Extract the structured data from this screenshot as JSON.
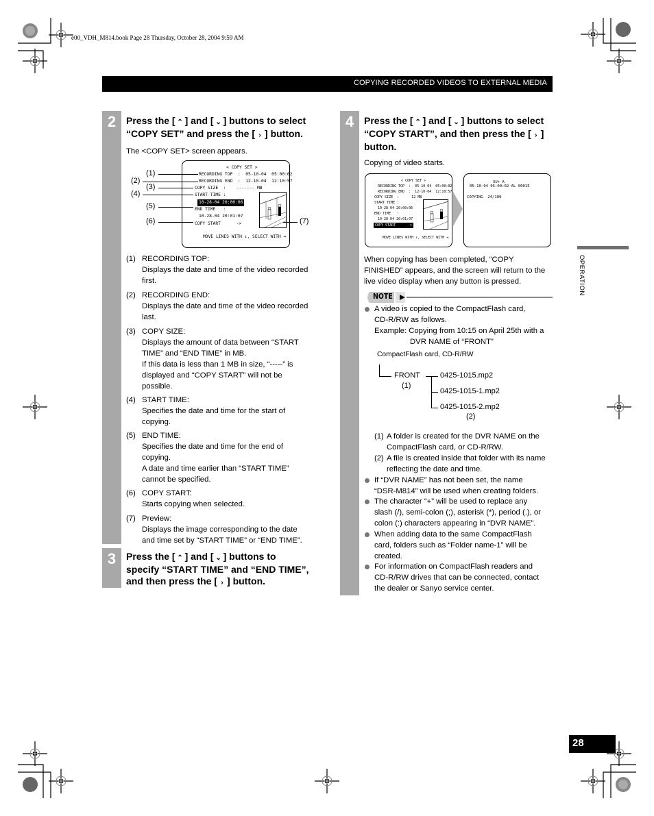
{
  "file_info": "e00_VDH_M814.book  Page 28  Thursday, October 28, 2004  9:59 AM",
  "header": {
    "title": "COPYING RECORDED VIDEOS TO EXTERNAL MEDIA"
  },
  "side_tab": {
    "label": "OPERATION"
  },
  "page_number": "28",
  "step2": {
    "number": "2",
    "title_line1": "Press the [",
    "title_line1_b": "] and [",
    "title_line1_c": "] buttons to select",
    "title_line2": "“COPY SET” and press the [",
    "title_line2_b": "] button.",
    "intro": "The <COPY SET> screen appears.",
    "screen": {
      "title": "< COPY SET >",
      "rows": [
        "RECORDING TOP  :  05-10-04  05:00:02",
        "RECORDING END  :  12-10-04  12:10:57",
        "COPY SIZE  :    ------- MB",
        "START TIME :",
        "10-28-04 20:00:06",
        "END TIME   :",
        "10-28-04 20:01:07",
        "COPY START      ->"
      ],
      "footer": "MOVE LINES WITH ↕, SELECT WITH ↔"
    },
    "callouts": [
      "(1)",
      "(2)",
      "(3)",
      "(4)",
      "(5)",
      "(6)",
      "(7)"
    ],
    "items": [
      {
        "num": "(1)",
        "lines": [
          "RECORDING TOP:",
          "Displays the date and time of the video recorded",
          "first."
        ]
      },
      {
        "num": "(2)",
        "lines": [
          "RECORDING END:",
          "Displays the date and time of the video recorded",
          "last."
        ]
      },
      {
        "num": "(3)",
        "lines": [
          "COPY SIZE:",
          "Displays the amount of data between “START",
          "TIME” and “END TIME” in MB.",
          "If this data is less than 1 MB in size, “-----” is",
          "displayed and “COPY START” will not be",
          "possible."
        ]
      },
      {
        "num": "(4)",
        "lines": [
          "START TIME:",
          "Specifies the date and time for the start of",
          "copying."
        ]
      },
      {
        "num": "(5)",
        "lines": [
          "END TIME:",
          "Specifies the date and time for the end of",
          "copying.",
          "A date and time earlier than “START TIME”",
          "cannot be specified."
        ]
      },
      {
        "num": "(6)",
        "lines": [
          "COPY START:",
          "Starts copying when selected."
        ]
      },
      {
        "num": "(7)",
        "lines": [
          "Preview:",
          "Displays the image corresponding to the date",
          "and time set by “START TIME” or “END TIME”."
        ]
      }
    ]
  },
  "step3": {
    "number": "3",
    "line1a": "Press the [",
    "line1b": "] and [",
    "line1c": "] buttons to",
    "line2": "specify “START TIME” and “END TIME”,",
    "line3a": "and then press the [",
    "line3b": "] button."
  },
  "step4": {
    "number": "4",
    "line1a": "Press the [",
    "line1b": "] and [",
    "line1c": "] buttons to select",
    "line2a": "“COPY START”, and then press the [",
    "line2b": "]",
    "line3": "button.",
    "intro": "Copying of video starts.",
    "screen1": {
      "title": "< COPY SET >",
      "rows": [
        "RECORDING TOP  :  05-10-04  05:00:02",
        "RECORDING END  :  12-10-04  12:10:57",
        "COPY SIZE  :      12 MB",
        "START TIME :",
        "10-28-04 20:00:06",
        "END TIME   :",
        "10-28-04 20:01:07",
        "COPY START      ->"
      ],
      "footer": "MOVE LINES WITH ↕, SELECT WITH ↔"
    },
    "screen2": {
      "line1": "SU+ A",
      "line2": "05-10-04 05:00:02 AL 00015",
      "line3": "COPYING  24/100"
    },
    "completion": [
      "When copying has been completed, “COPY",
      "FINISHED” appears, and the screen will return to the",
      "live video display when any button is pressed."
    ],
    "note_label": "NOTE",
    "note_bullet1": [
      "A video is copied to the CompactFlash card,",
      "CD-R/RW as follows.",
      "Example: Copying from 10:15 on April 25th with a",
      "DVR NAME of “FRONT”"
    ],
    "tree": {
      "root": "CompactFlash card, CD-R/RW",
      "folder": "FRONT",
      "folder_marker": "(1)",
      "files": [
        "0425-1015.mp2",
        "0425-1015-1.mp2",
        "0425-1015-2.mp2"
      ],
      "file_marker": "(2)"
    },
    "tree_notes": [
      {
        "num": "(1)",
        "lines": [
          "A folder is created for the DVR NAME on the",
          "CompactFlash card, or CD-R/RW."
        ]
      },
      {
        "num": "(2)",
        "lines": [
          "A file is created inside that folder with its name",
          "reflecting the date and time."
        ]
      }
    ],
    "bullets": [
      [
        "If “DVR NAME” has not been set, the name",
        "“DSR-M814” will be used when creating folders."
      ],
      [
        "The character “+” will be used to replace any",
        "slash (/), semi-colon (;), asterisk (*), period (.), or",
        "colon (:) characters appearing in “DVR NAME”."
      ],
      [
        "When adding data to the same CompactFlash",
        "card, folders such as “Folder name-1” will be",
        "created."
      ],
      [
        "For information on CompactFlash readers and",
        "CD-R/RW drives that can be connected, contact",
        "the dealer or Sanyo service center."
      ]
    ]
  }
}
